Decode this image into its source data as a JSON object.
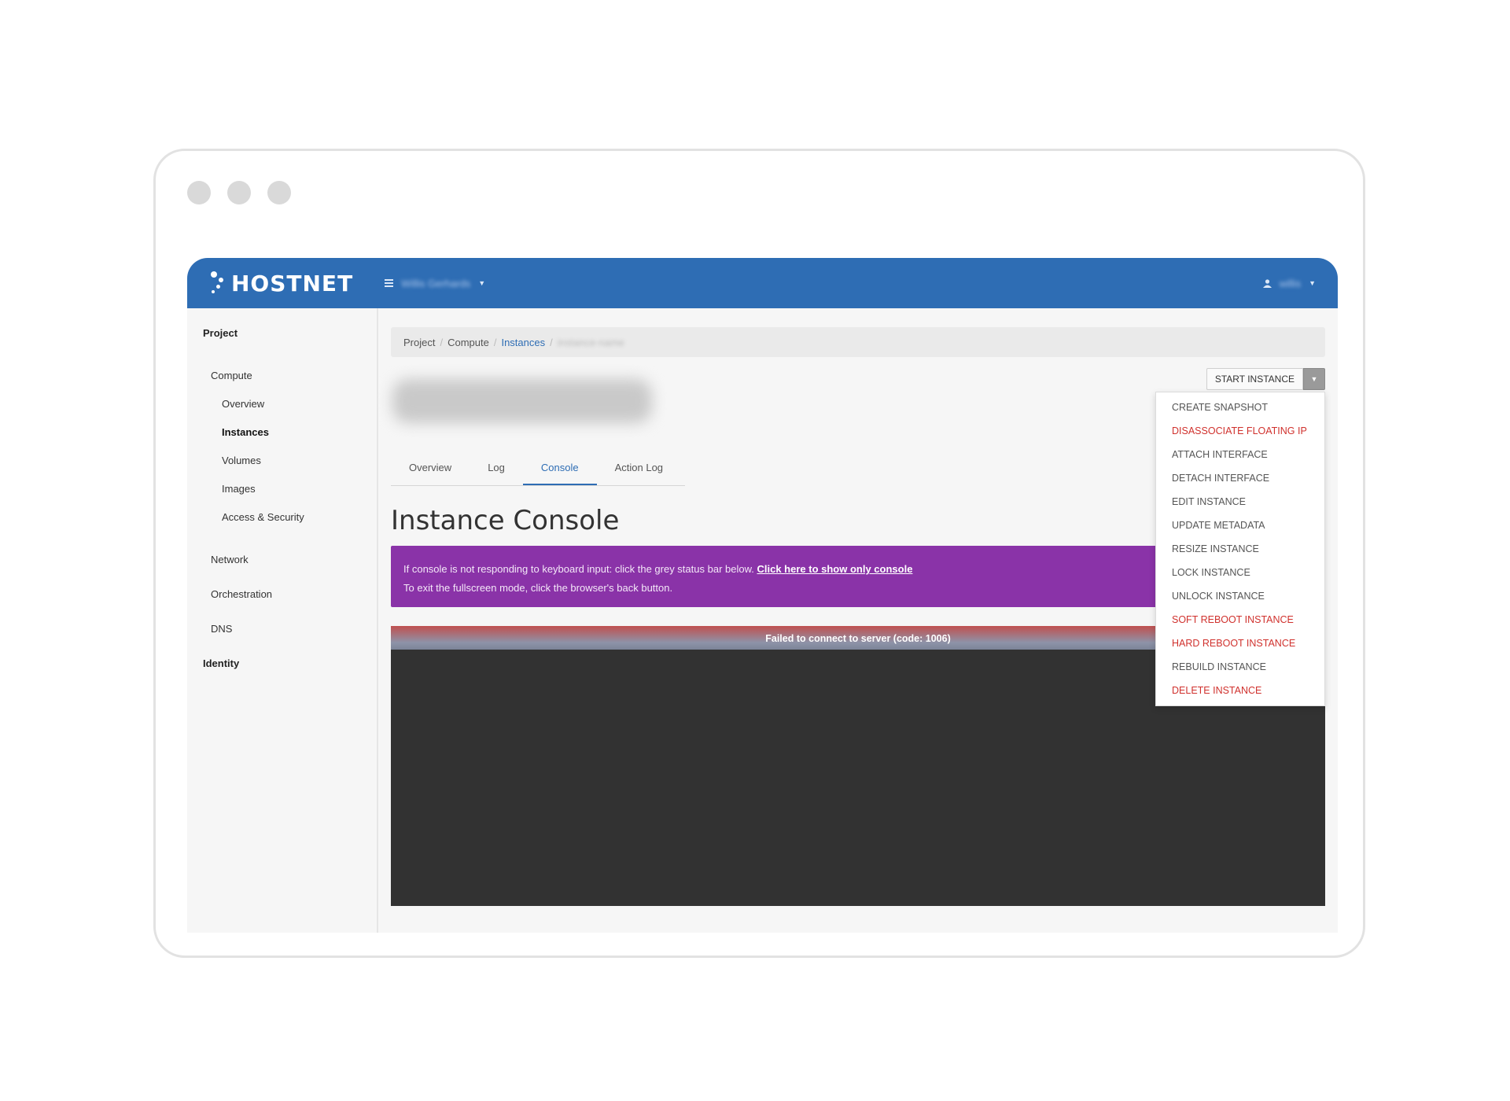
{
  "navbar": {
    "brand": "HOSTNET",
    "project_name": "Willis Gerhards",
    "user_name": "willis"
  },
  "sidebar": {
    "project_label": "Project",
    "compute_label": "Compute",
    "items": [
      "Overview",
      "Instances",
      "Volumes",
      "Images",
      "Access & Security"
    ],
    "network_label": "Network",
    "orchestration_label": "Orchestration",
    "dns_label": "DNS",
    "identity_label": "Identity"
  },
  "breadcrumb": {
    "project": "Project",
    "compute": "Compute",
    "instances": "Instances",
    "current": "instance-name",
    "separator": "/"
  },
  "actions": {
    "primary": "START INSTANCE",
    "menu": [
      {
        "label": "CREATE SNAPSHOT",
        "danger": false
      },
      {
        "label": "DISASSOCIATE FLOATING IP",
        "danger": true
      },
      {
        "label": "ATTACH INTERFACE",
        "danger": false
      },
      {
        "label": "DETACH INTERFACE",
        "danger": false
      },
      {
        "label": "EDIT INSTANCE",
        "danger": false
      },
      {
        "label": "UPDATE METADATA",
        "danger": false
      },
      {
        "label": "RESIZE INSTANCE",
        "danger": false
      },
      {
        "label": "LOCK INSTANCE",
        "danger": false
      },
      {
        "label": "UNLOCK INSTANCE",
        "danger": false
      },
      {
        "label": "SOFT REBOOT INSTANCE",
        "danger": true
      },
      {
        "label": "HARD REBOOT INSTANCE",
        "danger": true
      },
      {
        "label": "REBUILD INSTANCE",
        "danger": false
      },
      {
        "label": "DELETE INSTANCE",
        "danger": true
      }
    ]
  },
  "tabs": [
    "Overview",
    "Log",
    "Console",
    "Action Log"
  ],
  "console": {
    "title": "Instance Console",
    "alert_line1": "If console is not responding to keyboard input: click the grey status bar below.",
    "alert_link": "Click here to show only console",
    "alert_line2": "To exit the fullscreen mode, click the browser's back button.",
    "status": "Failed to connect to server (code: 1006)"
  },
  "colors": {
    "primary": "#2e6db4",
    "alert_bg": "#8a33a8",
    "danger": "#d0312d",
    "console_bg": "#323232"
  }
}
